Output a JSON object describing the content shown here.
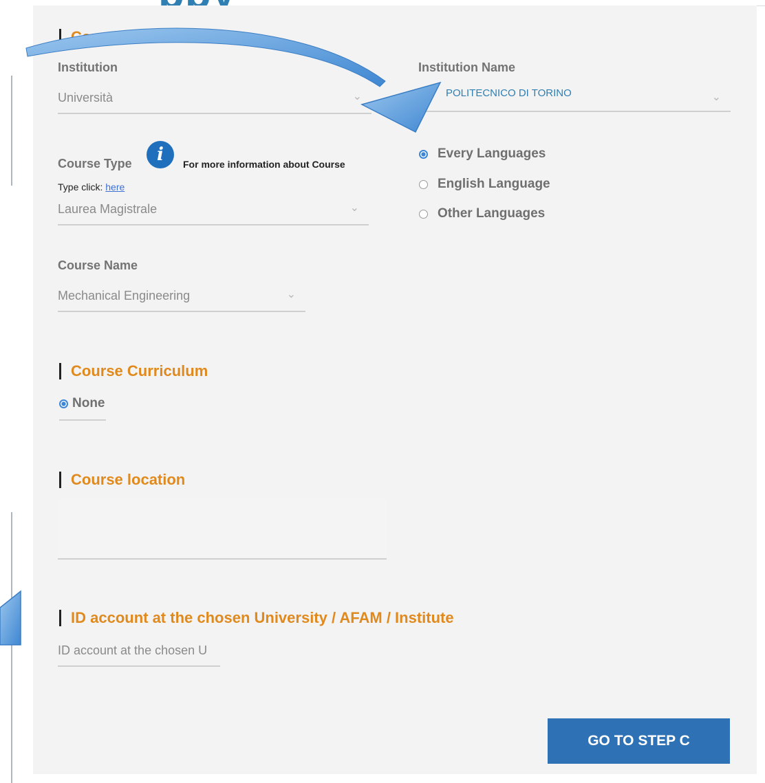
{
  "page_fragment": "ppy",
  "course_information": {
    "title": "Course information",
    "institution_label": "Institution",
    "institution_value": "Università",
    "institution_name_label": "Institution Name",
    "institution_name_value": "POLITECNICO DI TORINO",
    "course_type_label": "Course Type",
    "course_type_help": "For more information about Course",
    "course_type_click_prefix": "Type click:",
    "course_type_click_link": "here",
    "course_type_value": "Laurea Magistrale",
    "language_options": [
      {
        "label": "Every Languages",
        "selected": true
      },
      {
        "label": "English Language",
        "selected": false
      },
      {
        "label": "Other Languages",
        "selected": false
      }
    ],
    "course_name_label": "Course Name",
    "course_name_value": "Mechanical Engineering"
  },
  "course_curriculum": {
    "title": "Course Curriculum",
    "option_label": "None",
    "option_selected": true
  },
  "course_location": {
    "title": "Course location"
  },
  "id_account": {
    "title": "ID account at the chosen University / AFAM / Institute",
    "placeholder": "ID account at the chosen U"
  },
  "actions": {
    "go_to_step": "GO TO STEP C"
  },
  "icons": {
    "info": "info-icon",
    "chevron": "chevron-down-icon",
    "arrow": "curved-arrow"
  },
  "colors": {
    "accent_orange": "#e08a1e",
    "button_blue": "#2f71b5",
    "info_blue": "#1f6fbd",
    "radio_blue": "#3c86d6",
    "link_blue": "#3d6fd0",
    "panel_bg": "#f3f3f3"
  }
}
